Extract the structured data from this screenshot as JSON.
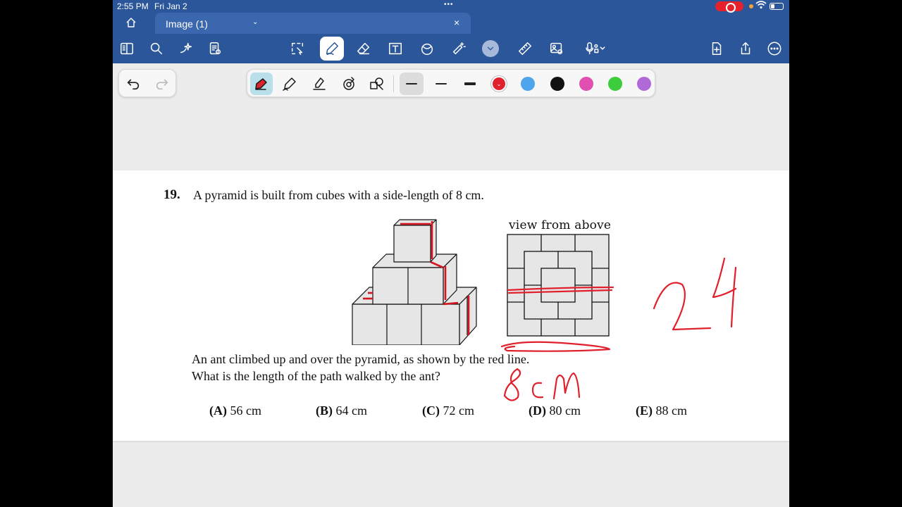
{
  "status_bar": {
    "time": "2:55 PM",
    "date": "Fri Jan 2",
    "dots": "•••"
  },
  "tab": {
    "name": "Image (1)",
    "chevron": "⌄",
    "close": "×"
  },
  "toolbar_icons": [
    "reader-view-icon",
    "search-icon",
    "ai-sparkle-icon",
    "page-settings-icon",
    "lasso-select-icon",
    "pen-icon",
    "eraser-icon",
    "text-box-icon",
    "shapes-icon",
    "sticker-icon",
    "more-tools-chevron-icon",
    "ruler-icon",
    "image-insert-icon",
    "audio-record-icon",
    "add-page-icon",
    "share-icon",
    "more-icon"
  ],
  "pen_colors": [
    "#e0202c",
    "#4ea5ee",
    "#111111",
    "#e14fb0",
    "#3ccc3c",
    "#b06ad8"
  ],
  "question": {
    "number": "19.",
    "text": "A pyramid is built from cubes with a side-length of 8 cm.",
    "line1": "An ant climbed up and over the pyramid, as shown by the red line.",
    "line2": "What is the length of the path walked by the ant?",
    "view_label": "view from above"
  },
  "answers": [
    {
      "letter": "(A)",
      "text": "56 cm"
    },
    {
      "letter": "(B)",
      "text": "64 cm"
    },
    {
      "letter": "(C)",
      "text": "72 cm"
    },
    {
      "letter": "(D)",
      "text": "80 cm"
    },
    {
      "letter": "(E)",
      "text": "88 cm"
    }
  ],
  "handwriting": {
    "number": "24",
    "unit": "8 cm"
  }
}
